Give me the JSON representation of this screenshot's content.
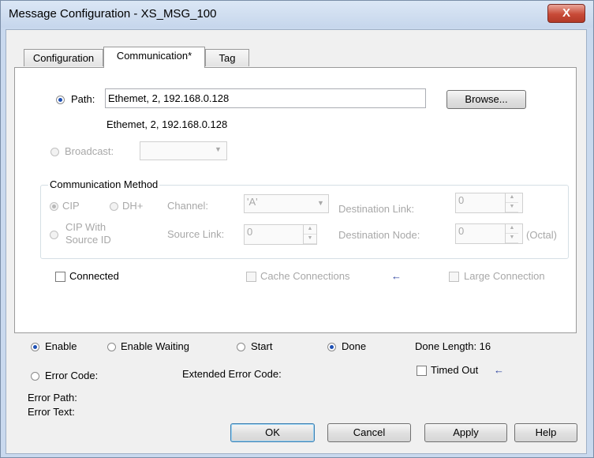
{
  "window": {
    "title": "Message Configuration - XS_MSG_100",
    "close_glyph": "X"
  },
  "tabs": [
    {
      "label": "Configuration"
    },
    {
      "label": "Communication*"
    },
    {
      "label": "Tag"
    }
  ],
  "communication": {
    "path_label": "Path:",
    "path_value": "Ethemet, 2, 192.168.0.128",
    "path_resolved": "Ethemet, 2, 192.168.0.128",
    "browse_label": "Browse...",
    "broadcast_label": "Broadcast:",
    "broadcast_value": "",
    "method_group_label": "Communication Method",
    "cip_label": "CIP",
    "dhplus_label": "DH+",
    "cip_with_source_label_1": "CIP With",
    "cip_with_source_label_2": "Source ID",
    "channel_label": "Channel:",
    "channel_value": "'A'",
    "destination_link_label": "Destination Link:",
    "destination_link_value": "0",
    "source_link_label": "Source Link:",
    "source_link_value": "0",
    "destination_node_label": "Destination Node:",
    "destination_node_value": "0",
    "octal_label": "(Octal)",
    "connected_label": "Connected",
    "cache_connections_label": "Cache Connections",
    "large_connection_label": "Large Connection",
    "arrow_glyph": "←"
  },
  "status": {
    "enable_label": "Enable",
    "enable_waiting_label": "Enable Waiting",
    "start_label": "Start",
    "done_label": "Done",
    "done_length_label": "Done Length: 16",
    "error_code_label": "Error Code:",
    "extended_error_label": "Extended Error Code:",
    "timed_out_label": "Timed Out",
    "error_path_label": "Error Path:",
    "error_text_label": "Error Text:"
  },
  "buttons": {
    "ok": "OK",
    "cancel": "Cancel",
    "apply": "Apply",
    "help": "Help"
  },
  "colors": {
    "titlebar": "#c6d6ec",
    "close_button": "#c84a37",
    "radio_selected": "#1e50b4",
    "arrow": "#2a3f9e"
  }
}
